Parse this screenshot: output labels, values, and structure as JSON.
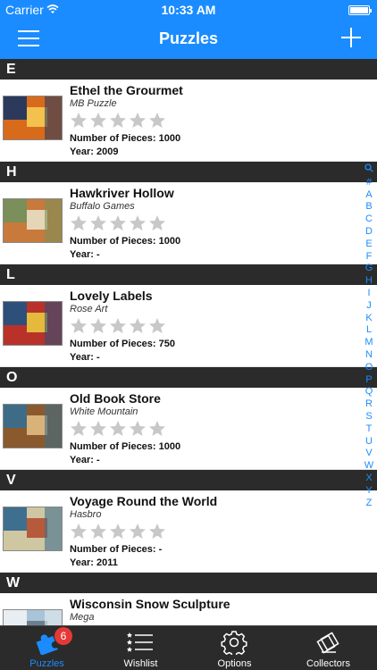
{
  "status": {
    "carrier": "Carrier",
    "time": "10:33 AM"
  },
  "nav": {
    "title": "Puzzles"
  },
  "sections": [
    {
      "letter": "E",
      "items": [
        {
          "title": "Ethel the Grourmet",
          "maker": "MB Puzzle",
          "pieces": "Number of Pieces: 1000",
          "year": "Year: 2009",
          "rating": 0,
          "thumb": [
            "#d86a1c",
            "#2b3a5c",
            "#f2c14e"
          ]
        }
      ]
    },
    {
      "letter": "H",
      "items": [
        {
          "title": "Hawkriver Hollow",
          "maker": "Buffalo Games",
          "pieces": "Number of Pieces: 1000",
          "year": "Year: -",
          "rating": 0,
          "thumb": [
            "#c77a3b",
            "#7a8f5a",
            "#e5d6b8"
          ]
        }
      ]
    },
    {
      "letter": "L",
      "items": [
        {
          "title": "Lovely Labels",
          "maker": "Rose Art",
          "pieces": "Number of Pieces: 750",
          "year": "Year: -",
          "rating": 0,
          "thumb": [
            "#b8322a",
            "#2d4f7a",
            "#e4b93c"
          ]
        }
      ]
    },
    {
      "letter": "O",
      "items": [
        {
          "title": "Old Book Store",
          "maker": "White Mountain",
          "pieces": "Number of Pieces: 1000",
          "year": "Year: -",
          "rating": 0,
          "thumb": [
            "#8a5a2e",
            "#3e6c86",
            "#d9b27a"
          ]
        }
      ]
    },
    {
      "letter": "V",
      "items": [
        {
          "title": "Voyage Round the World",
          "maker": "Hasbro",
          "pieces": "Number of Pieces: -",
          "year": "Year: 2011",
          "rating": 0,
          "thumb": [
            "#cfc6a2",
            "#3f6f8e",
            "#b55a3a"
          ]
        }
      ]
    },
    {
      "letter": "W",
      "items": [
        {
          "title": "Wisconsin Snow Sculpture",
          "maker": "Mega",
          "pieces": "",
          "year": "",
          "rating": 0,
          "thumb": [
            "#a9c4d8",
            "#e9eef2",
            "#6d7f8e"
          ]
        }
      ]
    }
  ],
  "index_letters": [
    "#",
    "A",
    "B",
    "C",
    "D",
    "E",
    "F",
    "G",
    "H",
    "I",
    "J",
    "K",
    "L",
    "M",
    "N",
    "O",
    "P",
    "Q",
    "R",
    "S",
    "T",
    "U",
    "V",
    "W",
    "X",
    "Y",
    "Z"
  ],
  "tabs": [
    {
      "label": "Puzzles",
      "icon": "puzzle-icon",
      "active": true,
      "badge": "6"
    },
    {
      "label": "Wishlist",
      "icon": "wishlist-icon",
      "active": false
    },
    {
      "label": "Options",
      "icon": "gear-icon",
      "active": false
    },
    {
      "label": "Collectors",
      "icon": "collectors-icon",
      "active": false
    }
  ],
  "colors": {
    "accent": "#1a8cff",
    "header": "#2b2b2b",
    "badge": "#e53935",
    "star_empty": "#c8c8c8"
  }
}
